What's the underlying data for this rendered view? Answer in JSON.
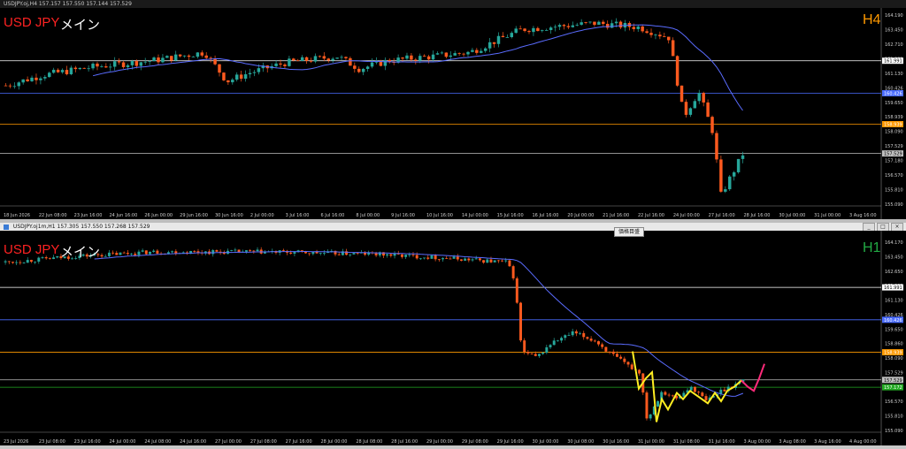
{
  "top": {
    "title": "USDJPY.oj,H4  157.157 157.550 157.144 157.529",
    "symbol_label": "USD JPY",
    "main_label": "メイン",
    "timeframe_label": "H4",
    "price_labels": [
      "164.190",
      "163.450",
      "162.710",
      "161.991",
      "161.130",
      "160.426",
      "159.650",
      "158.939",
      "158.090",
      "157.529",
      "157.180",
      "156.570",
      "155.810",
      "155.090"
    ],
    "hline_labels": [
      {
        "text": "161.991",
        "color": "#ffffff"
      },
      {
        "text": "160.426",
        "color": "#4a6cff"
      },
      {
        "text": "158.939",
        "color": "#ff9900"
      },
      {
        "text": "157.529",
        "color": "#bfbfbf"
      }
    ],
    "time_labels": [
      "18 Jun 2026",
      "22 Jun 08:00",
      "23 Jun 16:00",
      "24 Jun 16:00",
      "26 Jun 00:00",
      "29 Jun 16:00",
      "30 Jun 16:00",
      "2 Jul 00:00",
      "3 Jul 16:00",
      "6 Jul 16:00",
      "8 Jul 00:00",
      "9 Jul 16:00",
      "10 Jul 16:00",
      "14 Jul 00:00",
      "15 Jul 16:00",
      "16 Jul 16:00",
      "20 Jul 00:00",
      "21 Jul 16:00",
      "22 Jul 16:00",
      "24 Jul 00:00",
      "27 Jul 16:00",
      "28 Jul 16:00",
      "30 Jul 00:00",
      "31 Jul 00:00",
      "3 Aug 16:00"
    ]
  },
  "bottom": {
    "title": "USDJPY.oj1m,H1  157.305 157.550 157.268 157.529",
    "symbol_label": "USD JPY",
    "main_label": "メイン",
    "timeframe_label": "H1",
    "float_button": "価格目盛",
    "price_labels": [
      "164.170",
      "163.450",
      "162.650",
      "161.991",
      "161.130",
      "160.426",
      "159.650",
      "158.860",
      "158.090",
      "157.529",
      "157.172",
      "156.570",
      "155.810",
      "155.090"
    ],
    "hline_labels": [
      {
        "text": "161.991",
        "color": "#ffffff"
      },
      {
        "text": "160.426",
        "color": "#4a6cff"
      },
      {
        "text": "158.939",
        "color": "#ff9900"
      },
      {
        "text": "157.529",
        "color": "#bfbfbf"
      },
      {
        "text": "157.172",
        "color": "#22aa22"
      }
    ],
    "time_labels": [
      "23 Jul 2026",
      "23 Jul 08:00",
      "23 Jul 16:00",
      "24 Jul 00:00",
      "24 Jul 08:00",
      "24 Jul 16:00",
      "27 Jul 00:00",
      "27 Jul 08:00",
      "27 Jul 16:00",
      "28 Jul 00:00",
      "28 Jul 08:00",
      "28 Jul 16:00",
      "29 Jul 00:00",
      "29 Jul 08:00",
      "29 Jul 16:00",
      "30 Jul 00:00",
      "30 Jul 08:00",
      "30 Jul 16:00",
      "31 Jul 00:00",
      "31 Jul 08:00",
      "31 Jul 16:00",
      "3 Aug 00:00",
      "3 Aug 08:00",
      "3 Aug 16:00",
      "4 Aug 00:00"
    ],
    "win_buttons": [
      "_",
      "□",
      "×"
    ]
  },
  "colors": {
    "bull": "#26a69a",
    "bear": "#ff5a1f",
    "ma": "#5a6cff",
    "zigzag": "#ffee22",
    "forecast": "#ff2a7a"
  }
}
